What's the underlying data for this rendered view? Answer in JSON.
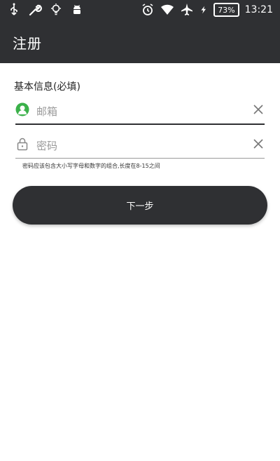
{
  "status_bar": {
    "battery": "73%",
    "time": "13:21",
    "icons_left": [
      "usb-icon",
      "wrench-icon",
      "lightbulb-icon",
      "android-icon"
    ],
    "icons_right": [
      "alarm-icon",
      "wifi-icon",
      "airplane-mode-icon",
      "charging-icon",
      "battery-icon"
    ]
  },
  "app_bar": {
    "title": "注册"
  },
  "form": {
    "section_title": "基本信息(必填)",
    "email": {
      "placeholder": "邮箱",
      "icon": "user-icon",
      "icon_color": "#3bb14a"
    },
    "password": {
      "placeholder": "密码",
      "icon": "lock-icon"
    },
    "password_hint": "密码应该包含大小写字母和数字的组合,长度在8-15之间",
    "next_label": "下一步"
  },
  "colors": {
    "primary_dark": "#2f3033",
    "accent_green": "#3bb14a"
  }
}
